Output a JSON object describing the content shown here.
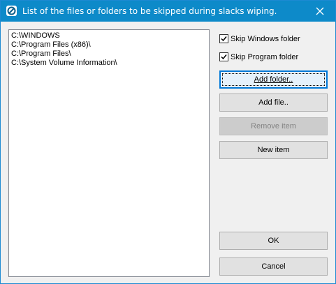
{
  "window": {
    "title": "List of the files or folders to be skipped during slacks wiping.",
    "app_icon": "no-sign-icon",
    "close_icon": "close-icon",
    "colors": {
      "titlebar": "#0d8ac9",
      "default_button_border": "#0078d7"
    }
  },
  "list": {
    "items": [
      "C:\\WINDOWS",
      "C:\\Program Files (x86)\\",
      "C:\\Program Files\\",
      "C:\\System Volume Information\\"
    ]
  },
  "options": {
    "skip_windows": {
      "label": "Skip Windows folder",
      "checked": true
    },
    "skip_program": {
      "label": "Skip Program folder",
      "checked": true
    }
  },
  "buttons": {
    "add_folder": {
      "label": "Add folder..",
      "state": "default"
    },
    "add_file": {
      "label": "Add file..",
      "state": "enabled"
    },
    "remove_item": {
      "label": "Remove item",
      "state": "disabled"
    },
    "new_item": {
      "label": "New item",
      "state": "enabled"
    },
    "ok": {
      "label": "OK",
      "state": "enabled"
    },
    "cancel": {
      "label": "Cancel",
      "state": "enabled"
    }
  }
}
